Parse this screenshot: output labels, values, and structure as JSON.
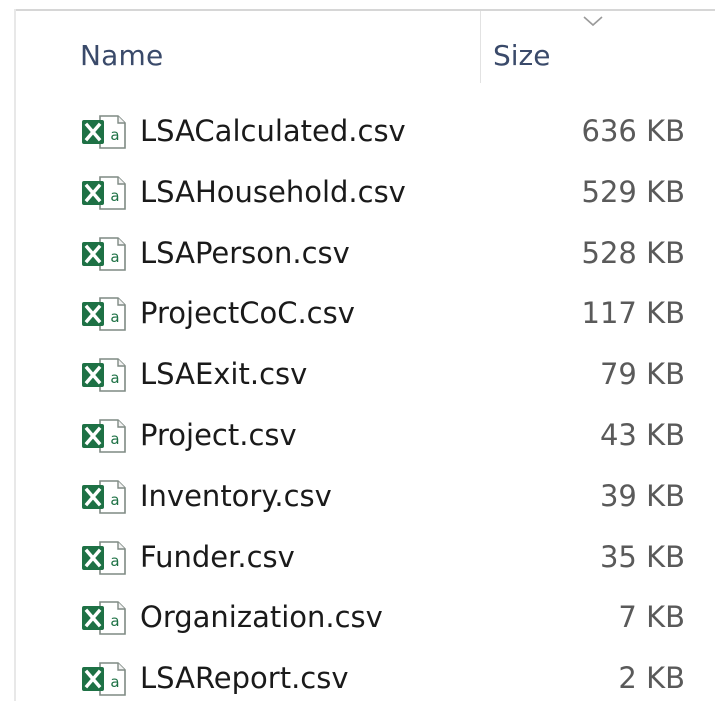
{
  "columns": {
    "name": "Name",
    "size": "Size"
  },
  "icons": {
    "file_type": "excel-csv-icon",
    "sort": "chevron-down-icon"
  },
  "colors": {
    "excel_green": "#1e7145",
    "header_text": "#3a4a6a"
  },
  "files": [
    {
      "name": "LSACalculated.csv",
      "size": "636 KB"
    },
    {
      "name": "LSAHousehold.csv",
      "size": "529 KB"
    },
    {
      "name": "LSAPerson.csv",
      "size": "528 KB"
    },
    {
      "name": "ProjectCoC.csv",
      "size": "117 KB"
    },
    {
      "name": "LSAExit.csv",
      "size": "79 KB"
    },
    {
      "name": "Project.csv",
      "size": "43 KB"
    },
    {
      "name": "Inventory.csv",
      "size": "39 KB"
    },
    {
      "name": "Funder.csv",
      "size": "35 KB"
    },
    {
      "name": "Organization.csv",
      "size": "7 KB"
    },
    {
      "name": "LSAReport.csv",
      "size": "2 KB"
    }
  ]
}
